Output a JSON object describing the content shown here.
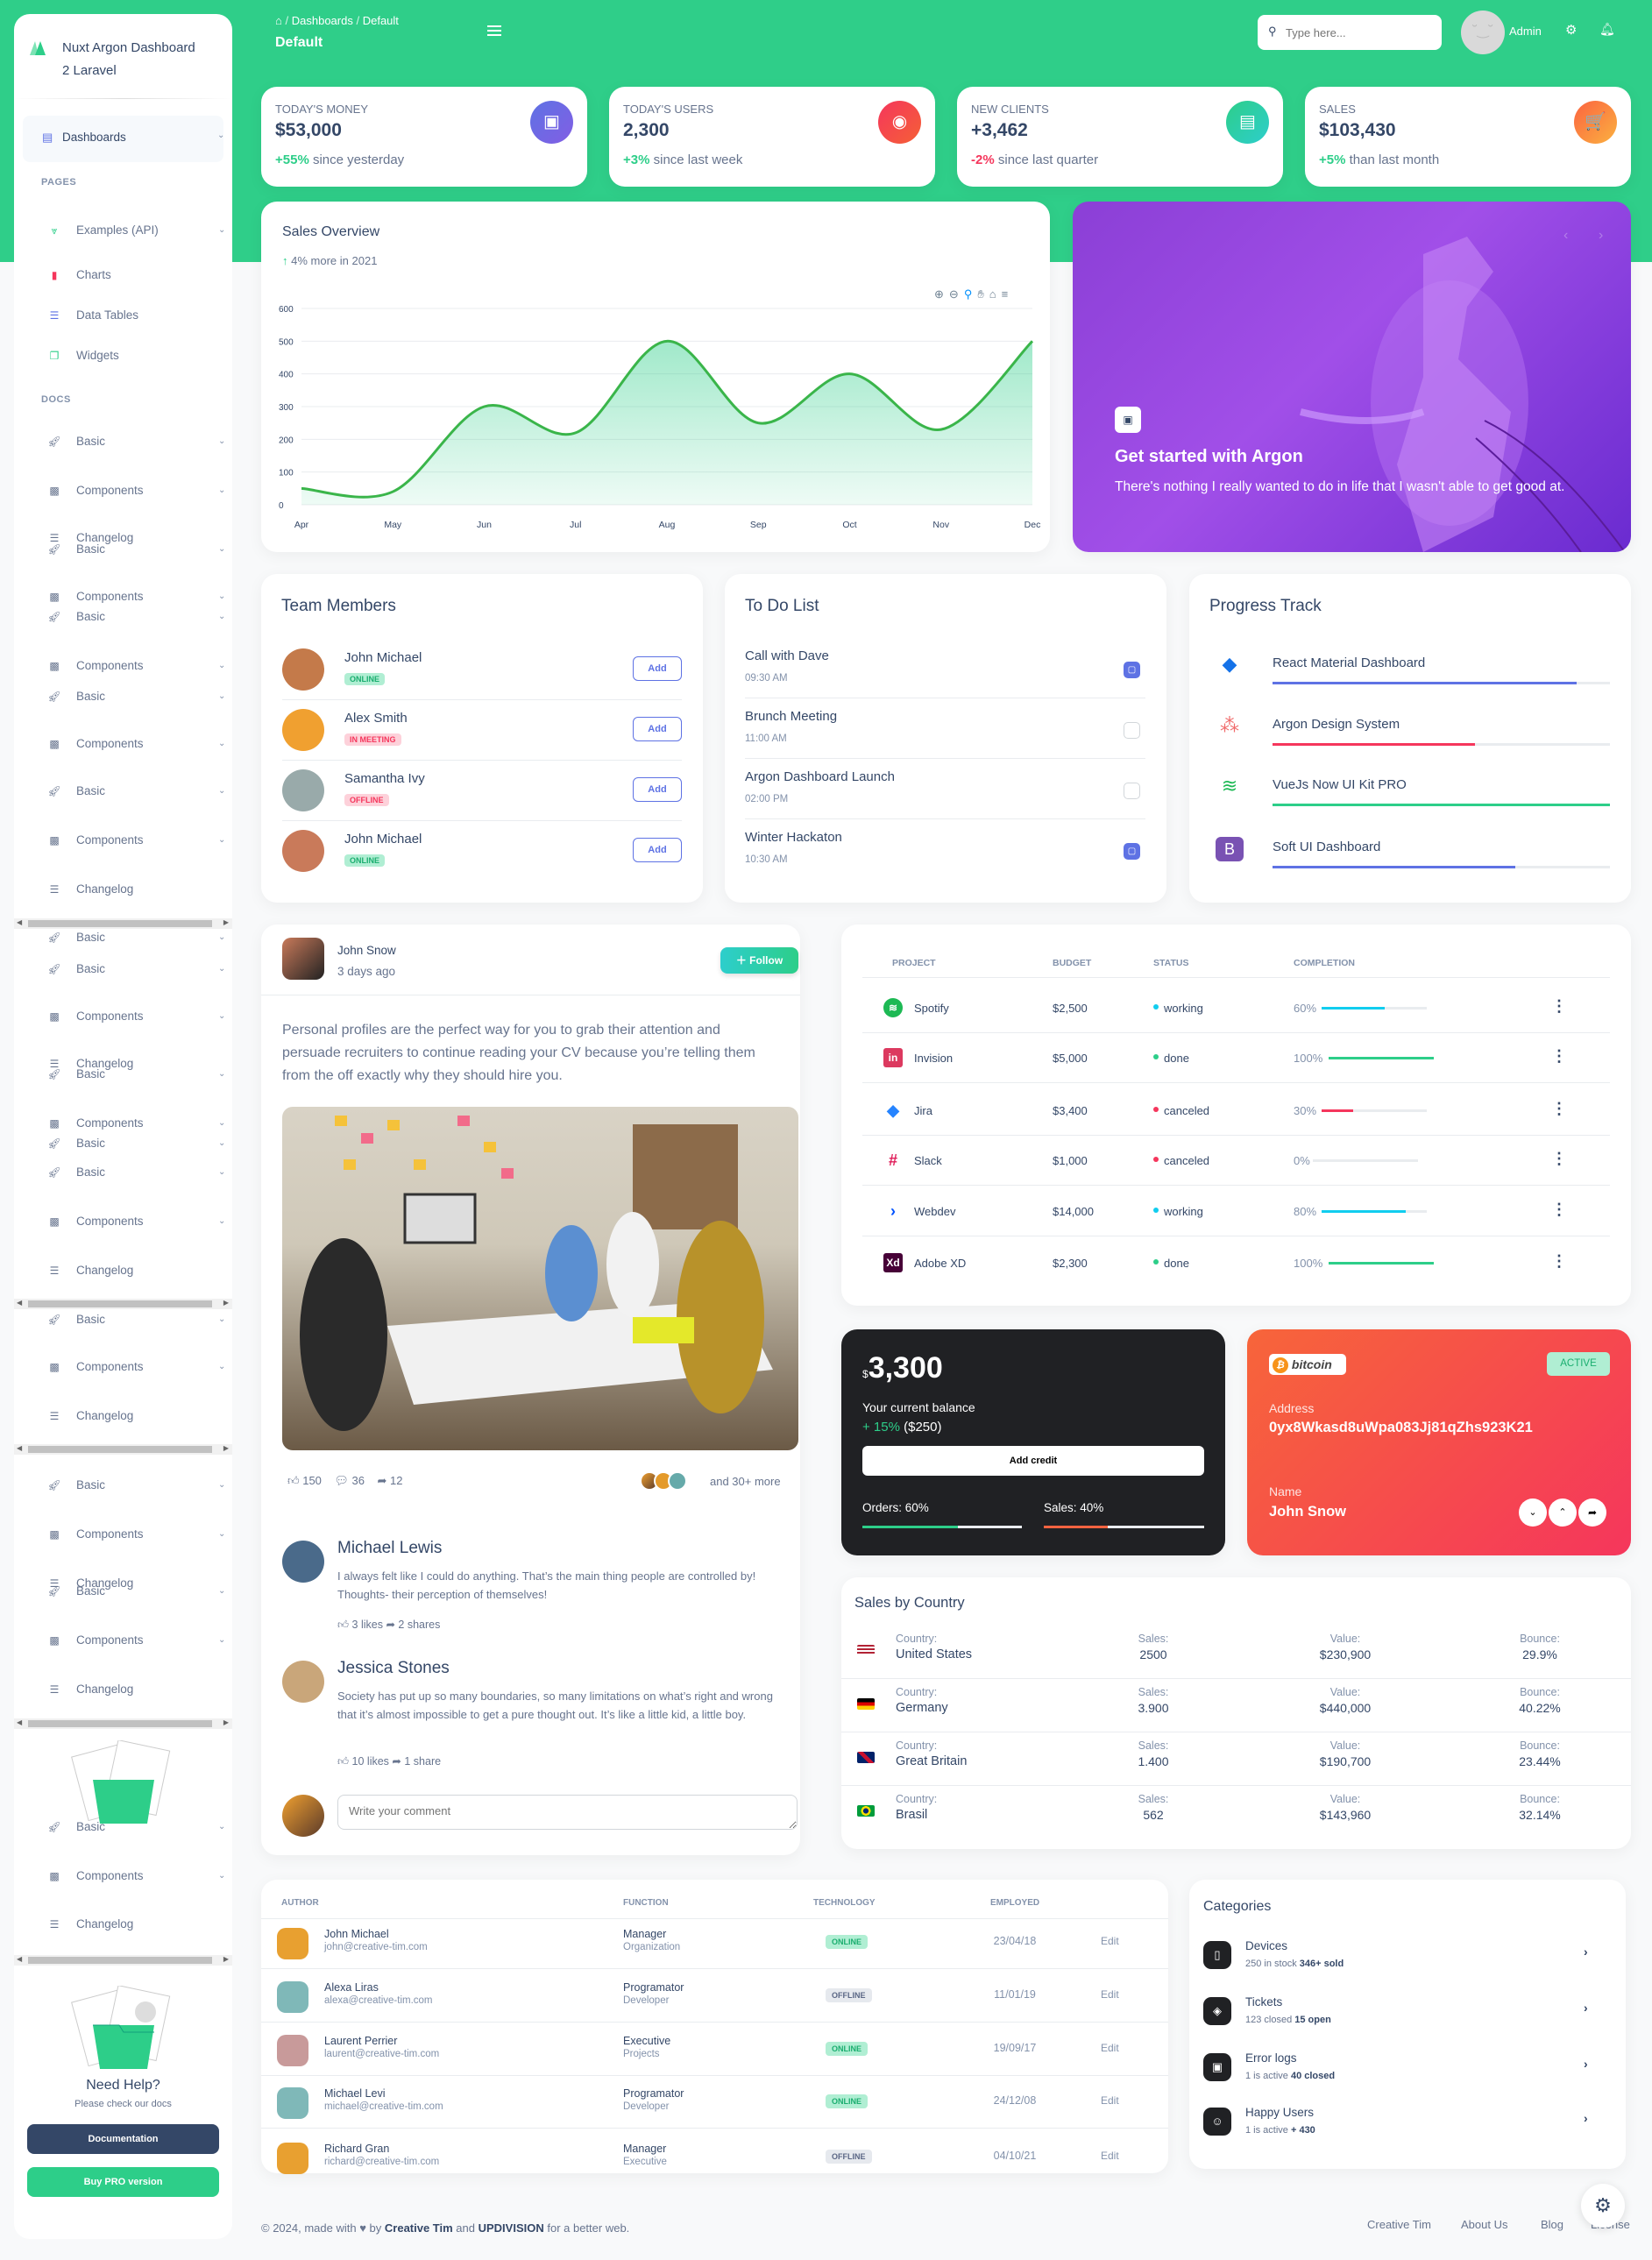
{
  "brand": {
    "name_line1": "Nuxt Argon Dashboard",
    "name_line2": "2 Laravel"
  },
  "sidebar": {
    "dashboards": "Dashboards",
    "pages_heading": "PAGES",
    "pages": [
      {
        "label": "Examples (API)",
        "icon": "ecommerce",
        "color": "#2dce89"
      },
      {
        "label": "Charts",
        "icon": "chart",
        "color": "#f5365c"
      },
      {
        "label": "Data Tables",
        "icon": "table",
        "color": "#5e72e4"
      },
      {
        "label": "Widgets",
        "icon": "widgets",
        "color": "#2dce89"
      }
    ],
    "docs_heading": "DOCS",
    "docs": [
      "Basic",
      "Components",
      "Changelog",
      "Basic",
      "Components",
      "Basic",
      "Components",
      "Basic",
      "Components",
      "Basic",
      "Components",
      "Changelog",
      "Basic",
      "Basic",
      "Components",
      "Changelog",
      "Basic",
      "Components",
      "Basic",
      "Basic",
      "Components",
      "Changelog",
      "Basic",
      "Components",
      "Changelog",
      "Basic",
      "Components",
      "Changelog",
      "Basic",
      "Components",
      "Changelog",
      "Basic",
      "Components",
      "Changelog"
    ],
    "help_title": "Need Help?",
    "help_sub": "Please check our docs",
    "documentation": "Documentation",
    "buy_pro": "Buy PRO version"
  },
  "topbar": {
    "breadcrumb": [
      "Dashboards",
      "Default"
    ],
    "page_title": "Default",
    "search_placeholder": "Type here...",
    "user": "Admin"
  },
  "stats": [
    {
      "label": "Today's Money",
      "value": "$53,000",
      "change": "+55%",
      "suffix": " since yesterday",
      "change_color": "#2dce89",
      "icon": "money-icon",
      "glyph": "▣",
      "bg": "linear-gradient(135deg,#5e72e4,#825ee4)"
    },
    {
      "label": "Today's Users",
      "value": "2,300",
      "change": "+3%",
      "suffix": " since last week",
      "change_color": "#2dce89",
      "icon": "world-icon",
      "glyph": "◉",
      "bg": "linear-gradient(135deg,#f5365c,#f56036)"
    },
    {
      "label": "New Clients",
      "value": "+3,462",
      "change": "-2%",
      "suffix": " since last quarter",
      "change_color": "#f5365c",
      "icon": "paper-icon",
      "glyph": "▤",
      "bg": "linear-gradient(135deg,#2dce89,#2dcecc)"
    },
    {
      "label": "Sales",
      "value": "$103,430",
      "change": "+5%",
      "suffix": " than last month",
      "change_color": "#2dce89",
      "icon": "cart-icon",
      "glyph": "🛒",
      "bg": "linear-gradient(135deg,#fb6340,#fbb140)"
    }
  ],
  "sales_overview": {
    "title": "Sales Overview",
    "change": "4% more",
    "suffix": " in 2021"
  },
  "chart_data": {
    "type": "area",
    "categories": [
      "Apr",
      "May",
      "Jun",
      "Jul",
      "Aug",
      "Sep",
      "Oct",
      "Nov",
      "Dec"
    ],
    "values": [
      50,
      40,
      300,
      220,
      500,
      250,
      400,
      230,
      500
    ],
    "ylim": [
      0,
      600
    ],
    "yticks": [
      0,
      100,
      200,
      300,
      400,
      500,
      600
    ],
    "grid": true,
    "color": "#2dce89"
  },
  "hero": {
    "title": "Get started with Argon",
    "text": "There's nothing I really wanted to do in life that I wasn't able to get good at."
  },
  "team": {
    "title": "Team Members",
    "add": "Add",
    "members": [
      {
        "name": "John Michael",
        "status": "Online",
        "cls": "b-on"
      },
      {
        "name": "Alex Smith",
        "status": "In Meeting",
        "cls": "b-meet"
      },
      {
        "name": "Samantha Ivy",
        "status": "Offline",
        "cls": "b-meet"
      },
      {
        "name": "John Michael",
        "status": "Online",
        "cls": "b-on"
      }
    ]
  },
  "todo": {
    "title": "To Do List",
    "items": [
      {
        "name": "Call with Dave",
        "time": "09:30 AM",
        "checked": true
      },
      {
        "name": "Brunch Meeting",
        "time": "11:00 AM",
        "checked": false
      },
      {
        "name": "Argon Dashboard Launch",
        "time": "02:00 PM",
        "checked": false
      },
      {
        "name": "Winter Hackaton",
        "time": "10:30 AM",
        "checked": true
      }
    ]
  },
  "progress": {
    "title": "Progress Track",
    "items": [
      {
        "name": "React Material Dashboard",
        "value": 90,
        "color": "#5e72e4",
        "icon": "react-icon",
        "glyph": "◆",
        "icolor": "#1572e8"
      },
      {
        "name": "Argon Design System",
        "value": 60,
        "color": "#f5365c",
        "icon": "asana-icon",
        "glyph": "⁂",
        "icolor": "#f06a6a"
      },
      {
        "name": "VueJs Now UI Kit PRO",
        "value": 100,
        "color": "#2dce89",
        "icon": "spotify-icon",
        "glyph": "≋",
        "icolor": "#1db954"
      },
      {
        "name": "Soft UI Dashboard",
        "value": 72,
        "color": "#5e72e4",
        "icon": "bootstrap-icon",
        "glyph": "B",
        "icolor": "#7952b3"
      }
    ]
  },
  "post": {
    "author": "John Snow",
    "time": "3 days ago",
    "follow": "Follow",
    "text": "Personal profiles are the perfect way for you to grab their attention and persuade recruiters to continue reading your CV because you’re telling them from the off exactly why they should hire you.",
    "likes": "150",
    "comments": "36",
    "shares": "12",
    "more": "and 30+ more",
    "replies": [
      {
        "name": "Michael Lewis",
        "text": "I always felt like I could do anything. That’s the main thing people are controlled by! Thoughts- their perception of themselves!",
        "likes": "3 likes",
        "shares": "2 shares"
      },
      {
        "name": "Jessica Stones",
        "text": "Society has put up so many boundaries, so many limitations on what’s right and wrong that it’s almost impossible to get a pure thought out. It’s like a little kid, a little boy.",
        "likes": "10 likes",
        "shares": "1 share"
      }
    ],
    "comment_placeholder": "Write your comment"
  },
  "projects": {
    "headers": [
      "Project",
      "Budget",
      "Status",
      "Completion"
    ],
    "rows": [
      {
        "name": "Spotify",
        "budget": "$2,500",
        "status": "working",
        "status_color": "#11cdef",
        "completion": 60,
        "bar": "#11cdef",
        "logo": "spotify-logo",
        "glyph": "≋",
        "lcolor": "#1db954"
      },
      {
        "name": "Invision",
        "budget": "$5,000",
        "status": "done",
        "status_color": "#2dce89",
        "completion": 100,
        "bar": "#2dce89",
        "logo": "invision-logo",
        "glyph": "in",
        "lcolor": "#dc395f"
      },
      {
        "name": "Jira",
        "budget": "$3,400",
        "status": "canceled",
        "status_color": "#f5365c",
        "completion": 30,
        "bar": "#f5365c",
        "logo": "jira-logo",
        "glyph": "◆",
        "lcolor": "#2684ff"
      },
      {
        "name": "Slack",
        "budget": "$1,000",
        "status": "canceled",
        "status_color": "#f5365c",
        "completion": 0,
        "bar": "#f5365c",
        "logo": "slack-logo",
        "glyph": "#",
        "lcolor": "#e01e5a"
      },
      {
        "name": "Webdev",
        "budget": "$14,000",
        "status": "working",
        "status_color": "#11cdef",
        "completion": 80,
        "bar": "#11cdef",
        "logo": "webdev-logo",
        "glyph": "›",
        "lcolor": "#0052ff"
      },
      {
        "name": "Adobe XD",
        "budget": "$2,300",
        "status": "done",
        "status_color": "#2dce89",
        "completion": 100,
        "bar": "#2dce89",
        "logo": "xd-logo",
        "glyph": "Xd",
        "lcolor": "#470137"
      }
    ]
  },
  "balance": {
    "currency": "$",
    "amount": "3,300",
    "label": "Your current balance",
    "change": "+ 15%",
    "change_amt": " ($250)",
    "button": "Add credit",
    "orders": "Orders: 60%",
    "sales": "Sales: 40%",
    "orders_value": 60,
    "sales_value": 40
  },
  "bitcoin": {
    "logo": "bitcoin",
    "status": "ACTIVE",
    "address_label": "Address",
    "address": "0yx8Wkasd8uWpa083Jj81qZhs923K21",
    "name_label": "Name",
    "name": "John Snow"
  },
  "countries": {
    "title": "Sales by Country",
    "labels": {
      "country": "Country:",
      "sales": "Sales:",
      "value": "Value:",
      "bounce": "Bounce:"
    },
    "rows": [
      {
        "country": "United States",
        "sales": "2500",
        "value": "$230,900",
        "bounce": "29.9%",
        "flag": "us"
      },
      {
        "country": "Germany",
        "sales": "3.900",
        "value": "$440,000",
        "bounce": "40.22%",
        "flag": "de"
      },
      {
        "country": "Great Britain",
        "sales": "1.400",
        "value": "$190,700",
        "bounce": "23.44%",
        "flag": "gb"
      },
      {
        "country": "Brasil",
        "sales": "562",
        "value": "$143,960",
        "bounce": "32.14%",
        "flag": "br"
      }
    ]
  },
  "authors": {
    "headers": [
      "Author",
      "Function",
      "Technology",
      "Employed"
    ],
    "edit": "Edit",
    "rows": [
      {
        "name": "John Michael",
        "email": "john@creative-tim.com",
        "role": "Manager",
        "dept": "Organization",
        "status": "Online",
        "date": "23/04/18"
      },
      {
        "name": "Alexa Liras",
        "email": "alexa@creative-tim.com",
        "role": "Programator",
        "dept": "Developer",
        "status": "Offline",
        "date": "11/01/19"
      },
      {
        "name": "Laurent Perrier",
        "email": "laurent@creative-tim.com",
        "role": "Executive",
        "dept": "Projects",
        "status": "Online",
        "date": "19/09/17"
      },
      {
        "name": "Michael Levi",
        "email": "michael@creative-tim.com",
        "role": "Programator",
        "dept": "Developer",
        "status": "Online",
        "date": "24/12/08"
      },
      {
        "name": "Richard Gran",
        "email": "richard@creative-tim.com",
        "role": "Manager",
        "dept": "Executive",
        "status": "Offline",
        "date": "04/10/21"
      }
    ]
  },
  "categories": {
    "title": "Categories",
    "items": [
      {
        "name": "Devices",
        "sub": "250 in stock ",
        "bold": "346+ sold",
        "icon": "mobile-icon",
        "glyph": "▯"
      },
      {
        "name": "Tickets",
        "sub": "123 closed ",
        "bold": "15 open",
        "icon": "tag-icon",
        "glyph": "◈"
      },
      {
        "name": "Error logs",
        "sub": "1 is active ",
        "bold": "40 closed",
        "icon": "box-icon",
        "glyph": "▣"
      },
      {
        "name": "Happy Users",
        "sub": "1 is active ",
        "bold": "+ 430",
        "icon": "smile-icon",
        "glyph": "☺"
      }
    ]
  },
  "footer": {
    "pre": "© 2024, made with ",
    "by": " by ",
    "ct": "Creative Tim",
    "and": " and ",
    "up": "UPDIVISION",
    "post": " for a better web.",
    "links": [
      "Creative Tim",
      "About Us",
      "Blog",
      "License"
    ]
  }
}
